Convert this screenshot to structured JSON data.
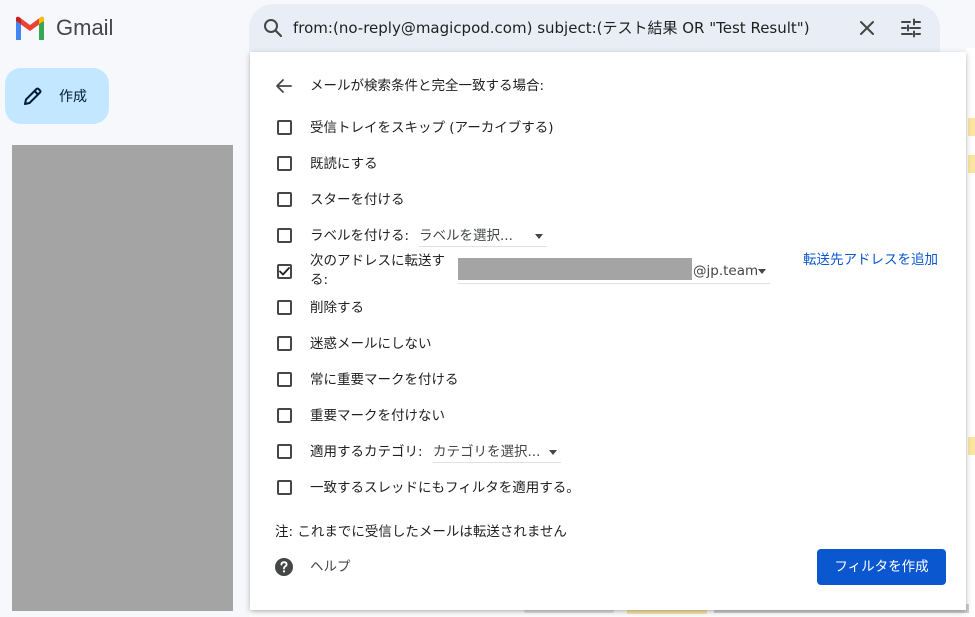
{
  "app": {
    "name": "Gmail",
    "brand_colors": [
      "#ea4335",
      "#fbbc04",
      "#34a853",
      "#4285f4",
      "#c5221f"
    ]
  },
  "search": {
    "query": "from:(no-reply@magicpod.com) subject:(テスト結果 OR \"Test Result\")"
  },
  "compose": {
    "label": "作成"
  },
  "filter_panel": {
    "title": "メールが検索条件と完全一致する場合:",
    "options": [
      {
        "label": "受信トレイをスキップ (アーカイブする)",
        "checked": false
      },
      {
        "label": "既読にする",
        "checked": false
      },
      {
        "label": "スターを付ける",
        "checked": false
      },
      {
        "label": "ラベルを付ける:",
        "checked": false,
        "select_value": "ラベルを選択..."
      },
      {
        "label": "次のアドレスに転送する:",
        "checked": true,
        "select_value": "@jp.team",
        "link": "転送先アドレスを追加"
      },
      {
        "label": "削除する",
        "checked": false
      },
      {
        "label": "迷惑メールにしない",
        "checked": false
      },
      {
        "label": "常に重要マークを付ける",
        "checked": false
      },
      {
        "label": "重要マークを付けない",
        "checked": false
      },
      {
        "label": "適用するカテゴリ:",
        "checked": false,
        "select_value": "カテゴリを選択..."
      },
      {
        "label": "一致するスレッドにもフィルタを適用する。",
        "checked": false
      }
    ],
    "note": "注: これまでに受信したメールは転送されません",
    "help_label": "ヘルプ",
    "create_button_label": "フィルタを作成",
    "accent_color": "#0b57d0"
  }
}
